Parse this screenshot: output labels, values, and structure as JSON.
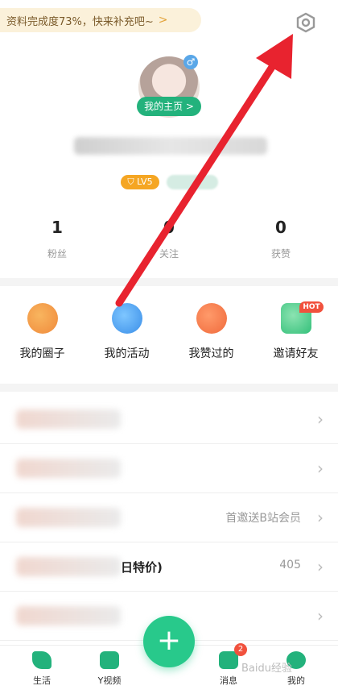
{
  "banner": {
    "text": "资料完成度73%，快来补充吧~",
    "chevron": ">"
  },
  "profile": {
    "gender_symbol": "♂",
    "home_button": "我的主页 >",
    "level_badge": "LV5"
  },
  "stats": [
    {
      "num": "1",
      "label": "粉丝"
    },
    {
      "num": "0",
      "label": "关注"
    },
    {
      "num": "0",
      "label": "获赞"
    }
  ],
  "grid": [
    {
      "label": "我的圈子",
      "icon": "planet-icon"
    },
    {
      "label": "我的活动",
      "icon": "activity-icon"
    },
    {
      "label": "我赞过的",
      "icon": "heart-icon"
    },
    {
      "label": "邀请好友",
      "icon": "gift-icon",
      "badge": "HOT"
    }
  ],
  "list": [
    {
      "right": ""
    },
    {
      "right": ""
    },
    {
      "right": "首邀送B站会员"
    },
    {
      "right": "405",
      "partial": "日特价)"
    },
    {
      "right": ""
    }
  ],
  "tabs": [
    {
      "label": "生活"
    },
    {
      "label": "Y视频"
    },
    {
      "label": "消息",
      "badge": "2"
    },
    {
      "label": "我的"
    }
  ],
  "fab": "+",
  "watermark": "Baidu经验",
  "colors": {
    "accent": "#28c98b",
    "arrow": "#e8232f"
  }
}
